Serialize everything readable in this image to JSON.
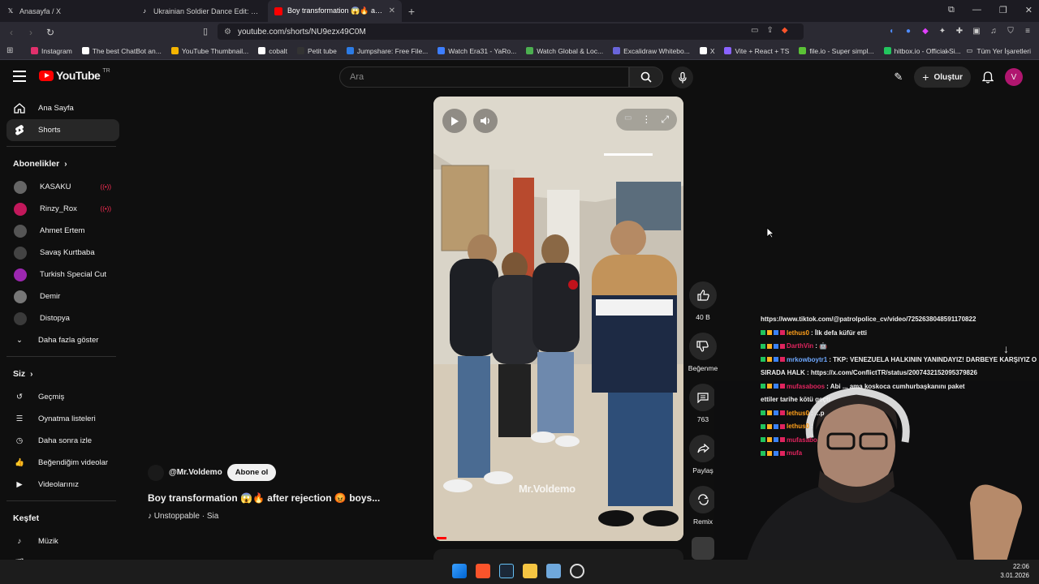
{
  "browser": {
    "tabs": [
      {
        "label": "Anasayfa / X",
        "icon": "x-logo-icon"
      },
      {
        "label": "Ukrainian Soldier Dance Edit: Me Gus",
        "icon": "tiktok-icon"
      },
      {
        "label": "Boy transformation 😱🔥 after r",
        "icon": "youtube-icon",
        "active": true
      }
    ],
    "new_tab": "+",
    "url": "youtube.com/shorts/NU9ezx49C0M",
    "bookmarks": [
      {
        "label": "Instagram",
        "color": "#e1306c"
      },
      {
        "label": "The best ChatBot an...",
        "color": "#ffffff"
      },
      {
        "label": "YouTube Thumbnail...",
        "color": "#f4b400"
      },
      {
        "label": "cobalt",
        "color": "#ffffff"
      },
      {
        "label": "Petit tube",
        "color": "#333333"
      },
      {
        "label": "Jumpshare: Free File...",
        "color": "#2c7be5"
      },
      {
        "label": "Watch Era31 - YaRo...",
        "color": "#3d7eff"
      },
      {
        "label": "Watch Global & Loc...",
        "color": "#4caf50"
      },
      {
        "label": "Excalidraw Whitebo...",
        "color": "#6965db"
      },
      {
        "label": "X",
        "color": "#ffffff"
      },
      {
        "label": "Vite + React + TS",
        "color": "#8a63ff"
      },
      {
        "label": "file.io - Super simpl...",
        "color": "#5bc236"
      },
      {
        "label": "hitbox.io - Official Si...",
        "color": "#22c55e"
      }
    ],
    "all_bookmarks": "Tüm Yer İşaretleri"
  },
  "youtube": {
    "logo_text": "YouTube",
    "region": "TR",
    "search_placeholder": "Ara",
    "create_label": "Oluştur",
    "avatar_letter": "V",
    "sidebar": {
      "main": [
        {
          "label": "Ana Sayfa",
          "icon": "home-icon"
        },
        {
          "label": "Shorts",
          "icon": "shorts-icon",
          "active": true
        }
      ],
      "subscriptions_title": "Abonelikler",
      "subscriptions": [
        {
          "label": "KASAKU",
          "color": "#666666",
          "live": true
        },
        {
          "label": "Rinzy_Rox",
          "color": "#c2185b",
          "live": true
        },
        {
          "label": "Ahmet Ertem",
          "color": "#555555"
        },
        {
          "label": "Savaş Kurtbaba",
          "color": "#444444"
        },
        {
          "label": "Turkish Special Cut",
          "color": "#9c27b0"
        },
        {
          "label": "Demir",
          "color": "#777777"
        },
        {
          "label": "Distopya",
          "color": "#3a3a3a"
        }
      ],
      "show_more": "Daha fazla göster",
      "you_title": "Siz",
      "you": [
        {
          "label": "Geçmiş",
          "icon": "history-icon"
        },
        {
          "label": "Oynatma listeleri",
          "icon": "playlist-icon"
        },
        {
          "label": "Daha sonra izle",
          "icon": "clock-icon"
        },
        {
          "label": "Beğendiğim videolar",
          "icon": "like-icon"
        },
        {
          "label": "Videolarınız",
          "icon": "video-icon"
        }
      ],
      "explore_title": "Keşfet",
      "explore": [
        {
          "label": "Müzik",
          "icon": "music-icon"
        },
        {
          "label": "Filmler ve TV",
          "icon": "film-icon"
        }
      ]
    },
    "short": {
      "channel": "@Mr.Voldemo",
      "subscribe": "Abone ol",
      "title": "Boy transformation 😱🔥 after rejection 😡 boys...",
      "music": "Unstoppable · Sia",
      "watermark": "Mr.Voldemo",
      "likes": "40 B",
      "dislike": "Beğenme",
      "comments": "763",
      "share": "Paylaş",
      "remix": "Remix"
    }
  },
  "chat": [
    {
      "user": "",
      "msg": "https://www.tiktok.com/@patrolpolice_cv/video/7252638048591170822",
      "color": "#ffffff"
    },
    {
      "user": "lethus0",
      "msg": ": İlk defa küfür etti",
      "color": "#ff9f1a"
    },
    {
      "user": "DarthVin",
      "msg": ": 🤖",
      "color": "#e0245e"
    },
    {
      "user": "mrkowboytr1",
      "msg": ": TKP: VENEZUELA HALKININ YANINDAYIZ! DARBEYE KARŞIYIZ O",
      "color": "#6ea8ff"
    },
    {
      "user": "",
      "msg": "SIRADA HALK : https://x.com/ConflictTR/status/2007432152095379826",
      "color": "#ffffff"
    },
    {
      "user": "mufasaboos",
      "msg": ": Abi ... ama koskoca cumhurbaşkanını paket",
      "color": "#e0245e"
    },
    {
      "user": "",
      "msg": "ettiler tarihe kötü geçti",
      "color": "#ffffff"
    },
    {
      "user": "lethus0",
      "msg": ": ...p",
      "color": "#ff9f1a"
    },
    {
      "user": "lethus0",
      "msg": ":",
      "color": "#ff9f1a"
    },
    {
      "user": "mufasabo",
      "msg": "",
      "color": "#e0245e"
    },
    {
      "user": "mufa",
      "msg": "",
      "color": "#e0245e"
    }
  ],
  "clock": {
    "time": "22:06",
    "date": "3.01.2026"
  }
}
